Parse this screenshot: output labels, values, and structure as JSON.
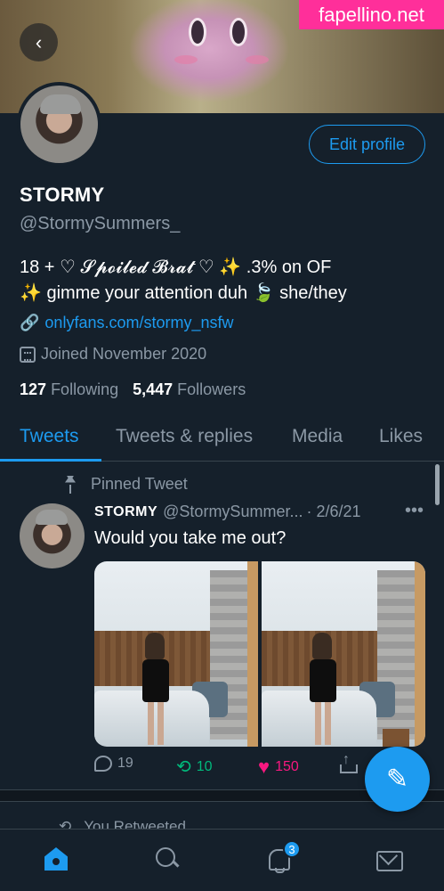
{
  "watermark": "fapellino.net",
  "header": {
    "back_icon": "chevron-left-icon"
  },
  "profile": {
    "edit_label": "Edit profile",
    "name": "STORMY",
    "handle": "@StormySummers_",
    "bio_line1": "18 + ♡ 𝓢𝓹𝓸𝓲𝓵𝓮𝓭 𝓑𝓻𝓪𝓽 ♡ ✨ .3% on OF",
    "bio_line2": "✨  gimme your attention duh 🍃 she/they",
    "link": "onlyfans.com/stormy_nsfw",
    "joined": "Joined November 2020",
    "following_count": "127",
    "following_label": "Following",
    "followers_count": "5,447",
    "followers_label": "Followers"
  },
  "tabs": [
    {
      "label": "Tweets",
      "active": true
    },
    {
      "label": "Tweets & replies",
      "active": false
    },
    {
      "label": "Media",
      "active": false
    },
    {
      "label": "Likes",
      "active": false
    }
  ],
  "pinned_tweet": {
    "pinned_label": "Pinned Tweet",
    "author_name": "STORMY",
    "author_handle": "@StormySummer...",
    "date": "· 2/6/21",
    "more": "•••",
    "text": "Would you take me out?",
    "replies": "19",
    "retweets": "10",
    "likes": "150"
  },
  "next_item": {
    "retweeted_label": "You Retweeted"
  },
  "fab": {
    "icon": "compose-tweet-icon",
    "glyph": "✎"
  },
  "nav": {
    "notification_badge": "3"
  },
  "colors": {
    "accent": "#1d9bf0",
    "background": "#15202b",
    "like": "#f91880",
    "retweet": "#00ba7c"
  }
}
